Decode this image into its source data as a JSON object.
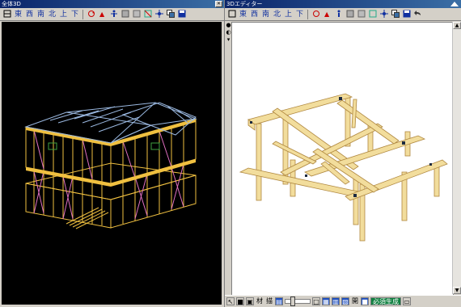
{
  "left_window": {
    "title": "全体3D",
    "toolbar": [
      "東",
      "西",
      "南",
      "北",
      "上",
      "下"
    ]
  },
  "right_window": {
    "title": "3Dエディター",
    "toolbar": [
      "東",
      "西",
      "南",
      "北",
      "上",
      "下"
    ]
  },
  "statusbar": {
    "label_a": "材",
    "label_b": "描",
    "label_c": "開",
    "green_btn": "必須生成"
  },
  "colors": {
    "title_bar": "#0a246a",
    "timber": "#f2dd9c",
    "frame_yellow": "#f0c040",
    "frame_blue": "#9ab8e0",
    "brace_pink": "#e070c0"
  },
  "icons": [
    "layout-icon",
    "person-icon",
    "level-icon",
    "grid-icon",
    "move-icon",
    "copy-icon",
    "save-icon",
    "undo-icon"
  ]
}
